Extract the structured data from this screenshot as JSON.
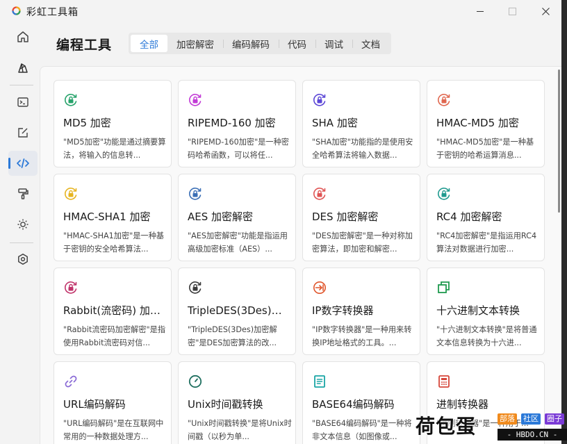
{
  "app": {
    "title": "彩虹工具箱"
  },
  "header": {
    "title": "编程工具"
  },
  "tabs": [
    {
      "label": "全部",
      "active": true
    },
    {
      "label": "加密解密"
    },
    {
      "label": "编码解码"
    },
    {
      "label": "代码"
    },
    {
      "label": "调试"
    },
    {
      "label": "文档"
    }
  ],
  "sidebar": [
    {
      "icon": "home-icon"
    },
    {
      "icon": "rainbow-icon"
    },
    {
      "icon": "terminal-icon"
    },
    {
      "icon": "edit-icon"
    },
    {
      "icon": "code-icon",
      "active": true
    },
    {
      "icon": "paint-roller-icon"
    },
    {
      "icon": "sun-icon"
    },
    {
      "icon": "settings-icon"
    }
  ],
  "cards": [
    {
      "title": "MD5 加密",
      "desc": "\"MD5加密\"功能是通过摘要算法，将输入的信息转...",
      "icon": "lock-refresh-icon",
      "color": "#27a36b"
    },
    {
      "title": "RIPEMD-160 加密",
      "desc": "\"RIPEMD-160加密\"是一种密码哈希函数，可以将任...",
      "icon": "lock-refresh-icon",
      "color": "#c23bd6"
    },
    {
      "title": "SHA 加密",
      "desc": "\"SHA加密\"功能指的是使用安全哈希算法将输入数据...",
      "icon": "lock-refresh-icon",
      "color": "#5b46d6"
    },
    {
      "title": "HMAC-MD5 加密",
      "desc": "\"HMAC-MD5加密\"是一种基于密钥的哈希运算消息...",
      "icon": "lock-refresh-icon",
      "color": "#e0674f"
    },
    {
      "title": "HMAC-SHA1 加密",
      "desc": "\"HMAC-SHA1加密\"是一种基于密钥的安全哈希算法...",
      "icon": "lock-refresh-icon",
      "color": "#e6b420"
    },
    {
      "title": "AES 加密解密",
      "desc": "\"AES加密解密\"功能是指运用高级加密标准（AES）...",
      "icon": "lock-refresh-icon",
      "color": "#3b6fb6"
    },
    {
      "title": "DES 加密解密",
      "desc": "\"DES加密解密\"是一种对称加密算法，即加密和解密...",
      "icon": "lock-refresh-icon",
      "color": "#e05454"
    },
    {
      "title": "RC4 加密解密",
      "desc": "\"RC4加密解密\"是指运用RC4算法对数据进行加密...",
      "icon": "lock-refresh-icon",
      "color": "#1f9a8f"
    },
    {
      "title": "Rabbit(流密码) 加密解密",
      "desc": "\"Rabbit流密码加密解密\"是指使用Rabbit流密码对信...",
      "icon": "lock-refresh-icon",
      "color": "#c0336a"
    },
    {
      "title": "TripleDES(3Des)加密解密",
      "desc": "\"TripleDES(3Des)加密解密\"是DES加密算法的改...",
      "icon": "lock-refresh-icon",
      "color": "#3a3a3a"
    },
    {
      "title": "IP数字转换器",
      "desc": "\"IP数字转换器\"是一种用来转换IP地址格式的工具。...",
      "icon": "login-arrow-icon",
      "color": "#e0552b"
    },
    {
      "title": "十六进制文本转换",
      "desc": "\"十六进制文本转换\"是将普通文本信息转换为十六进...",
      "icon": "copy-squares-icon",
      "color": "#1f9a4f"
    },
    {
      "title": "URL编码解码",
      "desc": "\"URL编码解码\"是在互联网中常用的一种数据处理方...",
      "icon": "link-icon",
      "color": "#8a6ad6"
    },
    {
      "title": "Unix时间戳转换",
      "desc": "\"Unix时间戳转换\"是将Unix时间戳（以秒为单...",
      "icon": "clock-icon",
      "color": "#1f6f5f"
    },
    {
      "title": "BASE64编码解码",
      "desc": "\"BASE64编码解码\"是一种将非文本信息（如图像或...",
      "icon": "document-icon",
      "color": "#1aa5a5"
    },
    {
      "title": "进制转换器",
      "desc": "\"进制转换器\"是一种用于...",
      "icon": "calculator-icon",
      "color": "#d6473b"
    }
  ],
  "watermark": {
    "main": "荷包蛋",
    "tags": [
      "部落",
      "社区",
      "圈子"
    ],
    "url": "- HBDO.CN -"
  }
}
